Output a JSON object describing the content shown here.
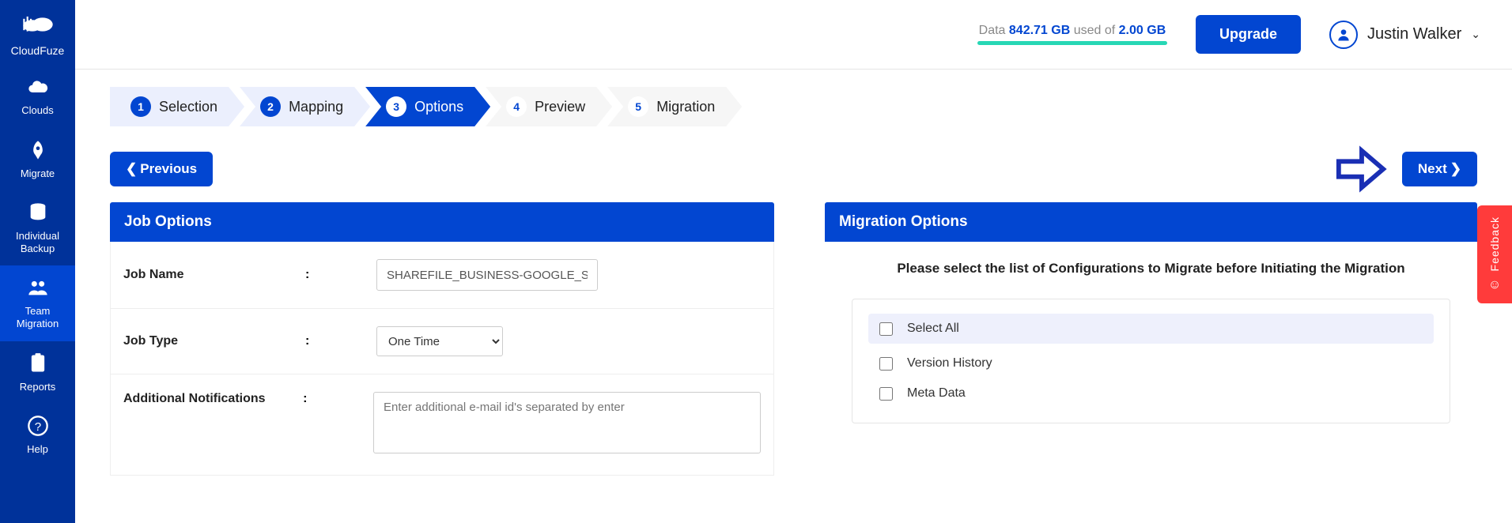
{
  "brand": "CloudFuze",
  "sidebar": [
    {
      "icon": "cloud",
      "label": "Clouds"
    },
    {
      "icon": "migrate",
      "label": "Migrate"
    },
    {
      "icon": "backup",
      "label": "Individual\nBackup"
    },
    {
      "icon": "team",
      "label": "Team\nMigration",
      "active": true
    },
    {
      "icon": "reports",
      "label": "Reports"
    },
    {
      "icon": "help",
      "label": "Help"
    }
  ],
  "header": {
    "data_prefix": "Data ",
    "data_used": "842.71 GB",
    "data_middle": " used of ",
    "data_total": "2.00 GB",
    "upgrade": "Upgrade",
    "user_name": "Justin Walker"
  },
  "steps": [
    {
      "num": "1",
      "label": "Selection",
      "state": "done"
    },
    {
      "num": "2",
      "label": "Mapping",
      "state": "done"
    },
    {
      "num": "3",
      "label": "Options",
      "state": "current"
    },
    {
      "num": "4",
      "label": "Preview",
      "state": "future"
    },
    {
      "num": "5",
      "label": "Migration",
      "state": "future"
    }
  ],
  "buttons": {
    "previous": "Previous",
    "next": "Next"
  },
  "job_options": {
    "title": "Job Options",
    "job_name_label": "Job Name",
    "job_name_value": "SHAREFILE_BUSINESS-GOOGLE_SHA",
    "job_type_label": "Job Type",
    "job_type_value": "One Time",
    "notif_label": "Additional Notifications",
    "notif_placeholder": "Enter additional e-mail id's separated by enter"
  },
  "migration_options": {
    "title": "Migration Options",
    "description": "Please select the list of Configurations to Migrate before Initiating the Migration",
    "select_all": "Select All",
    "items": [
      "Version History",
      "Meta Data"
    ]
  },
  "feedback": "Feedback"
}
